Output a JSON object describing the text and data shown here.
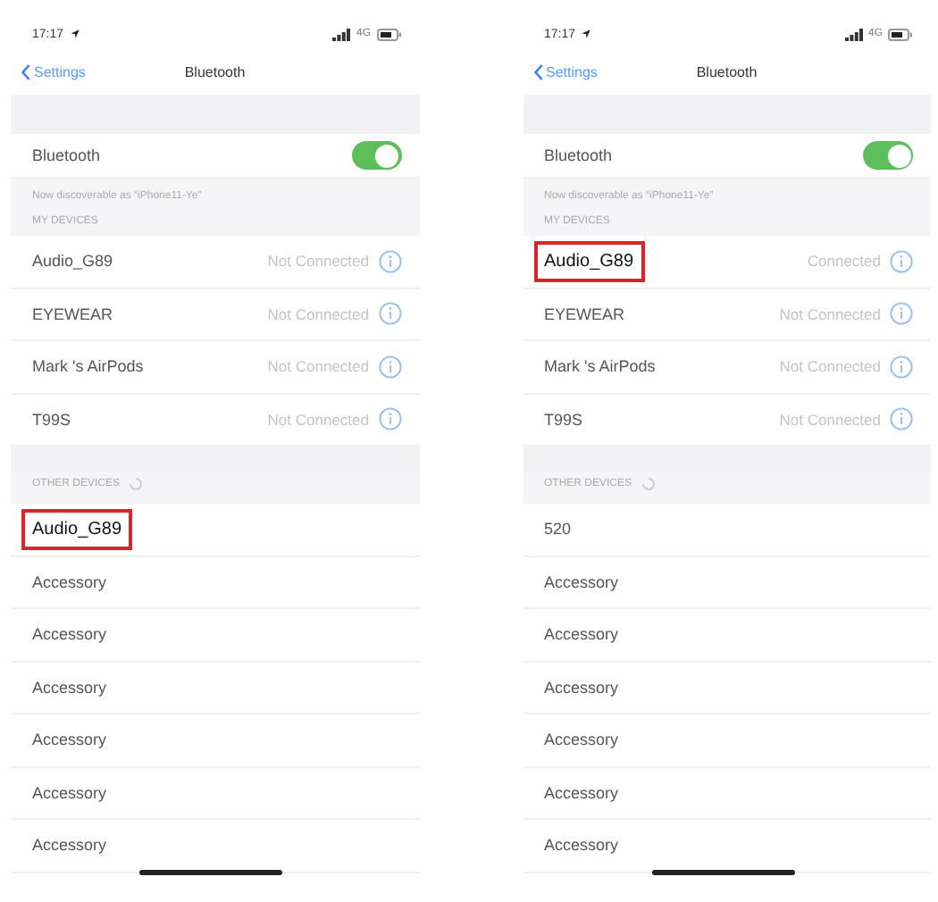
{
  "screens": [
    {
      "status_bar": {
        "time": "17:17",
        "network": "4G"
      },
      "nav": {
        "back": "Settings",
        "title": "Bluetooth"
      },
      "bluetooth": {
        "label": "Bluetooth",
        "on": true
      },
      "caption": "Now discoverable as “iPhone11-Ye”",
      "my_devices": {
        "header": "MY DEVICES",
        "devices": [
          {
            "name": "Audio_G89",
            "status": "Not Connected",
            "highlighted": false
          },
          {
            "name": "EYEWEAR",
            "status": "Not Connected",
            "highlighted": false
          },
          {
            "name": "Mark 's AirPods",
            "status": "Not Connected",
            "highlighted": false
          },
          {
            "name": "T99S",
            "status": "Not Connected",
            "highlighted": false
          }
        ]
      },
      "other_devices": {
        "header": "OTHER DEVICES",
        "devices": [
          {
            "name": "Audio_G89",
            "highlighted": true
          },
          {
            "name": "Accessory",
            "highlighted": false
          },
          {
            "name": "Accessory",
            "highlighted": false
          },
          {
            "name": "Accessory",
            "highlighted": false
          },
          {
            "name": "Accessory",
            "highlighted": false
          },
          {
            "name": "Accessory",
            "highlighted": false
          },
          {
            "name": "Accessory",
            "highlighted": false
          }
        ]
      }
    },
    {
      "status_bar": {
        "time": "17:17",
        "network": "4G"
      },
      "nav": {
        "back": "Settings",
        "title": "Bluetooth"
      },
      "bluetooth": {
        "label": "Bluetooth",
        "on": true
      },
      "caption": "Now discoverable as “iPhone11-Ye”",
      "my_devices": {
        "header": "MY DEVICES",
        "devices": [
          {
            "name": "Audio_G89",
            "status": "Connected",
            "highlighted": true
          },
          {
            "name": "EYEWEAR",
            "status": "Not Connected",
            "highlighted": false
          },
          {
            "name": "Mark 's AirPods",
            "status": "Not Connected",
            "highlighted": false
          },
          {
            "name": "T99S",
            "status": "Not Connected",
            "highlighted": false
          }
        ]
      },
      "other_devices": {
        "header": "OTHER DEVICES",
        "devices": [
          {
            "name": "520",
            "highlighted": false
          },
          {
            "name": "Accessory",
            "highlighted": false
          },
          {
            "name": "Accessory",
            "highlighted": false
          },
          {
            "name": "Accessory",
            "highlighted": false
          },
          {
            "name": "Accessory",
            "highlighted": false
          },
          {
            "name": "Accessory",
            "highlighted": false
          },
          {
            "name": "Accessory",
            "highlighted": false
          }
        ]
      }
    }
  ]
}
